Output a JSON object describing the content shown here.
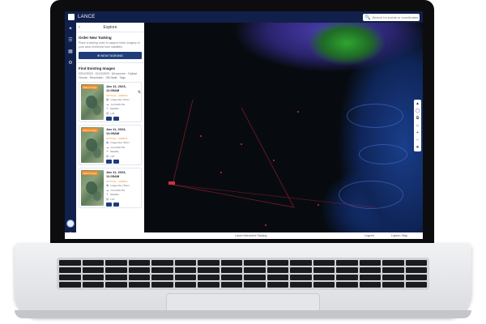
{
  "app": {
    "name": "LANCE"
  },
  "search": {
    "placeholder": "Search for points or coordinates"
  },
  "panel": {
    "title": "Explore",
    "order_title": "Order New Tasking",
    "order_text": "Place a tasking order to capture fresh imagery of your area of interest from satellites.",
    "new_button": "NEW TASKING",
    "existing_title": "Find Existing Images",
    "filter_line": "03/12/2023 - 01/11/2023 · All sources · Optical",
    "filter_chips": [
      "Clouds",
      "Resolution",
      "Off-Nadir",
      "Tags"
    ]
  },
  "cards": [
    {
      "badge": "Within 5 days",
      "date": "Jan 12, 2023, 11:05AM",
      "tag": "OPTICAL · AIRBUS",
      "rows": [
        "Image Res: 50cm",
        "CLOUDS 5%",
        "Satellite",
        "LAT"
      ]
    },
    {
      "badge": "Within 5 days",
      "date": "Jan 11, 2023, 11:05AM",
      "tag": "OPTICAL · AIRBUS",
      "rows": [
        "Image Res: 50cm",
        "CLOUDS 5%",
        "Satellite",
        "LAT"
      ]
    },
    {
      "badge": "Within 5 days",
      "date": "Jan 11, 2023, 11:05AM",
      "tag": "OPTICAL · AIRBUS",
      "rows": [
        "Image Res: 50cm",
        "CLOUDS 5%",
        "Satellite",
        "LAT"
      ]
    }
  ],
  "map": {
    "controls": [
      "▲",
      "◯",
      "⧉",
      "⌂",
      "+",
      "−",
      "⎈"
    ],
    "bottom_center": "Lance Interactive Tasking",
    "bottom_right_1": "Legend",
    "bottom_right_2": "Layers / Map"
  },
  "colors": {
    "nav": "#10204a",
    "accent": "#f28c28",
    "button": "#1f3d7a"
  },
  "icons": [
    "app-logo-icon",
    "search-icon",
    "satellite-icon",
    "layers-icon",
    "library-icon",
    "settings-icon",
    "back-icon",
    "plus-icon",
    "sort-icon",
    "image-icon",
    "cloud-icon",
    "calendar-icon"
  ]
}
